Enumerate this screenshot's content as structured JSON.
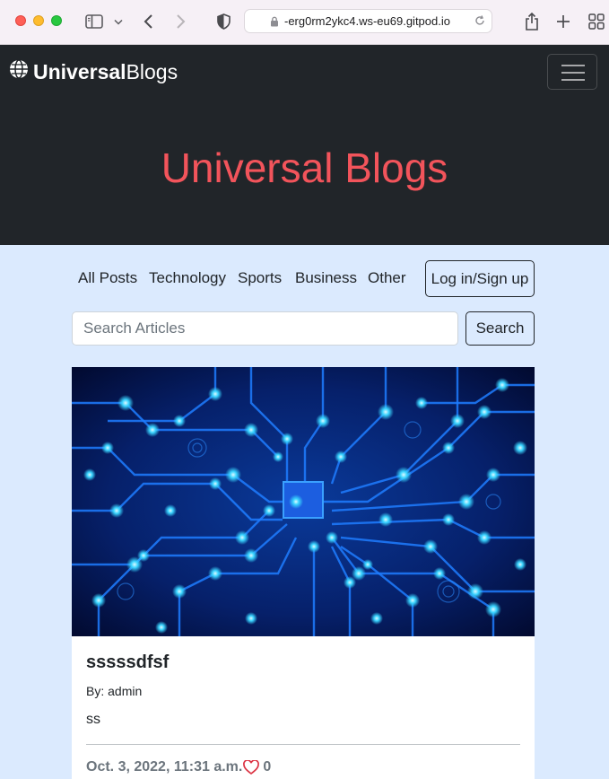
{
  "browser": {
    "url": "-erg0rm2ykc4.ws-eu69.gitpod.io",
    "icons": [
      "sidebar-icon",
      "chevron-down-icon",
      "back-icon",
      "forward-icon",
      "shield-icon",
      "lock-icon",
      "reload-icon",
      "share-icon",
      "new-tab-icon",
      "tab-overview-icon"
    ]
  },
  "navbar": {
    "brand_bold": "Universal",
    "brand_light": "Blogs",
    "brand_icon": "globe-icon",
    "toggler_icon": "hamburger-icon"
  },
  "hero": {
    "title": "Universal Blogs",
    "title_color": "#f2545b"
  },
  "categories": [
    "All Posts",
    "Technology",
    "Sports",
    "Business",
    "Other"
  ],
  "login_label": "Log in/Sign up",
  "search": {
    "placeholder": "Search Articles",
    "button_label": "Search"
  },
  "post": {
    "image": "circuit-board-image",
    "title": "sssssdfsf",
    "author": "By: admin",
    "body": "ss",
    "date": "Oct. 3, 2022, 11:31 a.m.",
    "likes": "0",
    "like_icon": "heart-icon"
  },
  "colors": {
    "dark": "#212529",
    "page_bg": "#dbeafe",
    "accent": "#f2545b",
    "heart": "#dc3545"
  }
}
